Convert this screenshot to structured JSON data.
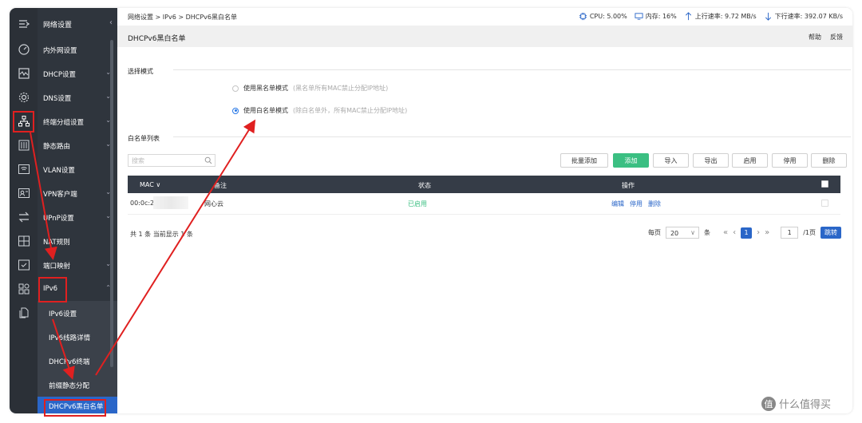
{
  "nav": {
    "title": "网络设置",
    "items": [
      {
        "label": "内外网设置"
      },
      {
        "label": "DHCP设置"
      },
      {
        "label": "DNS设置"
      },
      {
        "label": "终端分组设置"
      },
      {
        "label": "静态路由"
      },
      {
        "label": "VLAN设置"
      },
      {
        "label": "VPN客户端"
      },
      {
        "label": "UPnP设置"
      },
      {
        "label": "NAT规则"
      },
      {
        "label": "端口映射"
      },
      {
        "label": "IPv6"
      }
    ],
    "sub_items": [
      {
        "label": "IPv6设置"
      },
      {
        "label": "IPv6线路详情"
      },
      {
        "label": "DHCPv6终端"
      },
      {
        "label": "前缀静态分配"
      },
      {
        "label": "DHCPv6黑白名单"
      }
    ]
  },
  "rail_icons": [
    "menu-icon",
    "dashboard-icon",
    "monitor-icon",
    "settings-icon",
    "network-icon",
    "equalizer-icon",
    "wifi-icon",
    "vpn-icon",
    "transfer-icon",
    "grid-icon",
    "check-icon",
    "apps-icon",
    "copy-icon"
  ],
  "breadcrumb": "网络设置 > IPv6 > DHCPv6黑白名单",
  "stats": {
    "cpu": "CPU: 5.00%",
    "mem": "内存: 16%",
    "up": "上行速率: 9.72 MB/s",
    "down": "下行速率: 392.07 KB/s"
  },
  "page_title": "DHCPv6黑白名单",
  "help": "帮助",
  "feedback": "反馈",
  "mode_section": "选择模式",
  "modes": [
    {
      "label": "使用黑名单模式",
      "hint": "(黑名单所有MAC禁止分配IP地址)",
      "selected": false
    },
    {
      "label": "使用白名单模式",
      "hint": "(除白名单外，所有MAC禁止分配IP地址)",
      "selected": true
    }
  ],
  "list_section": "白名单列表",
  "search_placeholder": "搜索",
  "buttons": {
    "batch_add": "批量添加",
    "add": "添加",
    "import": "导入",
    "export": "导出",
    "enable": "启用",
    "disable": "停用",
    "delete": "删除"
  },
  "table": {
    "headers": {
      "mac": "MAC",
      "remark": "备注",
      "status": "状态",
      "ops": "操作"
    },
    "rows": [
      {
        "mac": "00:0c:2",
        "remark": "网心云",
        "status": "已启用",
        "edit": "编辑",
        "disable": "停用",
        "delete": "删除"
      }
    ]
  },
  "footer": {
    "count": "共 1 条 当前显示 1 条",
    "per_page": "每页",
    "page_size": "20",
    "unit": "条",
    "current_page": "1",
    "page_input": "1",
    "total_pages": "/1页",
    "jump": "跳转"
  },
  "watermark": "什么值得买",
  "watermark_badge": "值",
  "colors": {
    "accent": "#2a66c8",
    "add_button": "#3bbf82",
    "annotation": "#e02020",
    "sidebar": "#2f353d"
  }
}
